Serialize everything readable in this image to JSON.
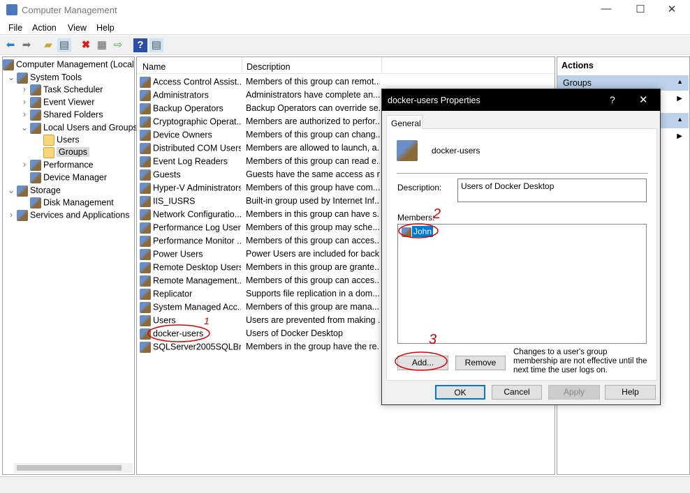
{
  "window": {
    "title": "Computer Management",
    "minimize": "—",
    "maximize": "☐",
    "close": "✕"
  },
  "menu": [
    "File",
    "Action",
    "View",
    "Help"
  ],
  "toolbar": [
    "back-icon",
    "forward-icon",
    "up-folder-icon",
    "show-hide-tree-icon",
    "delete-icon",
    "properties-icon",
    "export-icon",
    "help-icon",
    "show-hide-action-pane-icon"
  ],
  "tree": [
    {
      "label": "Computer Management (Local",
      "indent": 0,
      "expander": ""
    },
    {
      "label": "System Tools",
      "indent": 1,
      "expander": "⌄"
    },
    {
      "label": "Task Scheduler",
      "indent": 2,
      "expander": "›"
    },
    {
      "label": "Event Viewer",
      "indent": 2,
      "expander": "›"
    },
    {
      "label": "Shared Folders",
      "indent": 2,
      "expander": "›"
    },
    {
      "label": "Local Users and Groups",
      "indent": 2,
      "expander": "⌄"
    },
    {
      "label": "Users",
      "indent": 3,
      "expander": ""
    },
    {
      "label": "Groups",
      "indent": 3,
      "expander": "",
      "selected": true
    },
    {
      "label": "Performance",
      "indent": 2,
      "expander": "›"
    },
    {
      "label": "Device Manager",
      "indent": 2,
      "expander": ""
    },
    {
      "label": "Storage",
      "indent": 1,
      "expander": "⌄"
    },
    {
      "label": "Disk Management",
      "indent": 2,
      "expander": ""
    },
    {
      "label": "Services and Applications",
      "indent": 1,
      "expander": "›"
    }
  ],
  "list": {
    "columns": [
      "Name",
      "Description"
    ],
    "rows": [
      [
        "Access Control Assist...",
        "Members of this group can remot..."
      ],
      [
        "Administrators",
        "Administrators have complete an..."
      ],
      [
        "Backup Operators",
        "Backup Operators can override se..."
      ],
      [
        "Cryptographic Operat...",
        "Members are authorized to perfor..."
      ],
      [
        "Device Owners",
        "Members of this group can chang..."
      ],
      [
        "Distributed COM Users",
        "Members are allowed to launch, a..."
      ],
      [
        "Event Log Readers",
        "Members of this group can read e..."
      ],
      [
        "Guests",
        "Guests have the same access as m..."
      ],
      [
        "Hyper-V Administrators",
        "Members of this group have com..."
      ],
      [
        "IIS_IUSRS",
        "Built-in group used by Internet Inf..."
      ],
      [
        "Network Configuratio...",
        "Members in this group can have s..."
      ],
      [
        "Performance Log Users",
        "Members of this group may sche..."
      ],
      [
        "Performance Monitor ...",
        "Members of this group can acces..."
      ],
      [
        "Power Users",
        "Power Users are included for back..."
      ],
      [
        "Remote Desktop Users",
        "Members in this group are grante..."
      ],
      [
        "Remote Management...",
        "Members of this group can acces..."
      ],
      [
        "Replicator",
        "Supports file replication in a dom..."
      ],
      [
        "System Managed Acc...",
        "Members of this group are mana..."
      ],
      [
        "Users",
        "Users are prevented from making ..."
      ],
      [
        "docker-users",
        "Users of Docker Desktop"
      ],
      [
        "SQLServer2005SQLBro...",
        "Members in the group have the re..."
      ]
    ]
  },
  "actions": {
    "title": "Actions",
    "section1": "Groups"
  },
  "dialog": {
    "title": "docker-users Properties",
    "help": "?",
    "close": "✕",
    "tab": "General",
    "group_name": "docker-users",
    "description_label": "Description:",
    "description_value": "Users of Docker Desktop",
    "members_label": "Members:",
    "members": [
      "John"
    ],
    "add": "Add...",
    "remove": "Remove",
    "note": "Changes to a user's group membership are not effective until the next time the user logs on.",
    "ok": "OK",
    "cancel": "Cancel",
    "apply": "Apply",
    "help_btn": "Help"
  },
  "annotations": {
    "color": "#e00000",
    "n1": "1",
    "n2": "2",
    "n3": "3"
  }
}
